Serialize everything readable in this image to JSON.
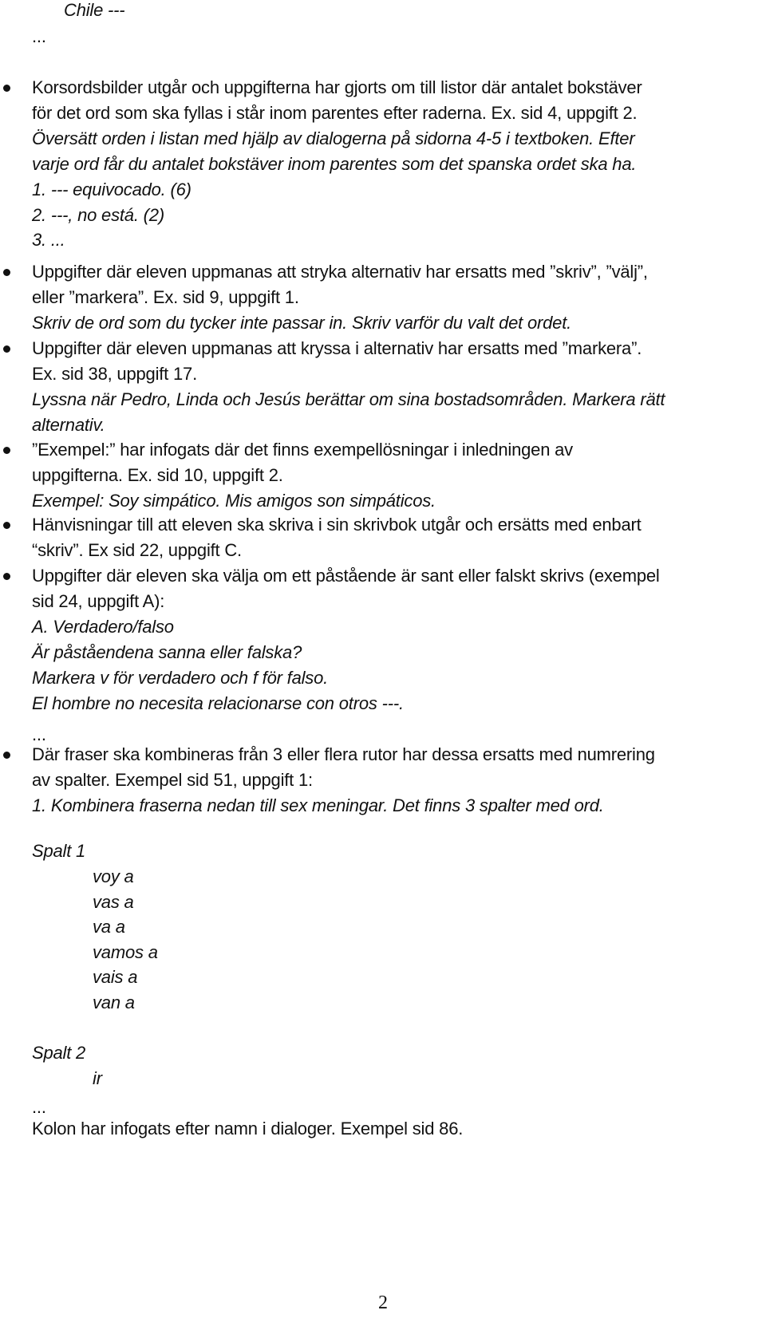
{
  "document": {
    "header_lines": {
      "chile": "Chile ---",
      "ellipsis": "..."
    },
    "bullets": [
      {
        "lines": [
          {
            "text": "Korsordsbilder utgår och uppgifterna har gjorts om till listor där antalet bokstäver",
            "italic": false
          },
          {
            "text": "för det ord som ska fyllas i står inom parentes efter raderna. Ex. sid 4, uppgift 2.",
            "italic": false
          },
          {
            "text": "Översätt orden i listan med hjälp av dialogerna på sidorna 4-5 i textboken. Efter",
            "italic": true
          },
          {
            "text": "varje ord får du antalet bokstäver inom parentes som det spanska ordet ska ha.",
            "italic": true
          },
          {
            "text": "1.   --- equivocado. (6)",
            "italic": true
          },
          {
            "text": "2.   ---, no está. (2)",
            "italic": true
          },
          {
            "text": "3.   ...",
            "italic": true
          }
        ]
      },
      {
        "lines": [
          {
            "text": "Uppgifter där eleven uppmanas att stryka alternativ har ersatts med ”skriv”, ”välj”,",
            "italic": false
          },
          {
            "text": "eller ”markera”. Ex. sid 9, uppgift 1.",
            "italic": false
          },
          {
            "text": "Skriv de ord som du tycker inte passar in. Skriv varför du valt det ordet.",
            "italic": true
          }
        ]
      },
      {
        "lines": [
          {
            "text": "Uppgifter där eleven uppmanas att kryssa i alternativ har ersatts med ”markera”.",
            "italic": false
          },
          {
            "text": "Ex. sid 38, uppgift 17.",
            "italic": false
          },
          {
            "text": "Lyssna när Pedro, Linda och Jesús berättar om sina bostadsområden. Markera rätt",
            "italic": true
          },
          {
            "text": "alternativ.",
            "italic": true
          }
        ]
      },
      {
        "lines": [
          {
            "text": "”Exempel:” har infogats där det finns exempellösningar i inledningen av",
            "italic": false
          },
          {
            "text": "uppgifterna. Ex. sid 10, uppgift 2.",
            "italic": false
          },
          {
            "text": "Exempel: Soy simpático. Mis amigos son simpáticos.",
            "italic": true
          }
        ]
      },
      {
        "lines": [
          {
            "text": "Hänvisningar till att eleven ska skriva i sin skrivbok utgår och ersätts med enbart",
            "italic": false
          },
          {
            "text": "“skriv”.  Ex sid 22, uppgift C.",
            "italic": false
          }
        ]
      },
      {
        "lines": [
          {
            "text": "Uppgifter där eleven ska välja om ett påstående är sant eller falskt skrivs (exempel",
            "italic": false
          },
          {
            "text": "sid 24, uppgift A):",
            "italic": false
          },
          {
            "text": "A. Verdadero/falso",
            "italic": true
          },
          {
            "text": "Är påståendena sanna eller falska?",
            "italic": true
          },
          {
            "text": "Markera v för verdadero och f för falso.",
            "italic": true
          },
          {
            "text": "El hombre no necesita relacionarse con otros ---.",
            "italic": true
          },
          {
            "text": "...",
            "italic": false
          }
        ]
      },
      {
        "lines": [
          {
            "text": "Där fraser ska kombineras från 3 eller flera rutor har dessa ersatts med numrering",
            "italic": false
          },
          {
            "text": "av spalter. Exempel sid 51, uppgift 1:",
            "italic": false
          },
          {
            "text": "1. Kombinera fraserna nedan till sex meningar. Det finns 3 spalter med ord.",
            "italic": true
          }
        ]
      }
    ],
    "columns": [
      {
        "heading": "Spalt 1",
        "items": [
          "voy a",
          "vas a",
          "va a",
          "vamos a",
          "vais a",
          "van a"
        ]
      },
      {
        "heading": "Spalt 2",
        "items": [
          "ir"
        ]
      }
    ],
    "footer_ellipsis": "...",
    "final_line": "Kolon har infogats efter namn i dialoger. Exempel sid 86.",
    "page_number": "2"
  }
}
